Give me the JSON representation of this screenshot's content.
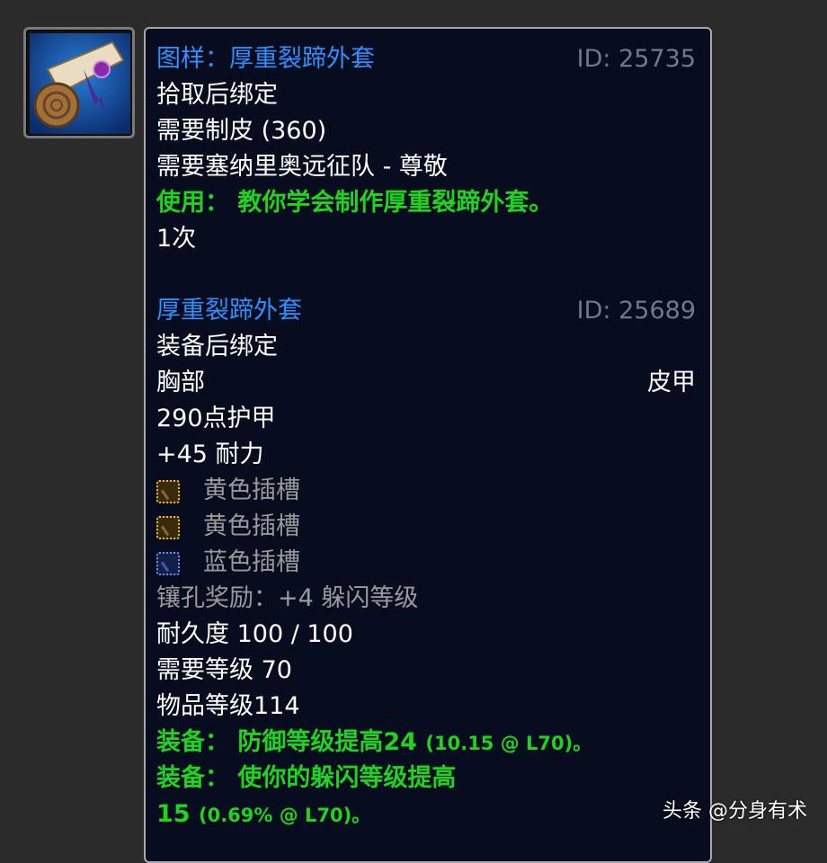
{
  "recipe": {
    "name": "图样：厚重裂蹄外套",
    "id": "ID: 25735",
    "bind": "拾取后绑定",
    "requires_skill": "需要制皮 (360)",
    "requires_rep": "需要塞纳里奥远征队 - 尊敬",
    "use_text": "使用： 教你学会制作厚重裂蹄外套。",
    "charges": "1次"
  },
  "item": {
    "name": "厚重裂蹄外套",
    "id": "ID: 25689",
    "bind": "装备后绑定",
    "slot": "胸部",
    "type": "皮甲",
    "armor": "290点护甲",
    "stamina": "+45 耐力",
    "sockets": [
      {
        "label": "黄色插槽",
        "color": "yellow"
      },
      {
        "label": "黄色插槽",
        "color": "yellow"
      },
      {
        "label": "蓝色插槽",
        "color": "blue"
      }
    ],
    "socket_bonus": "镶孔奖励：+4 躲闪等级",
    "durability": "耐久度 100 / 100",
    "req_level": "需要等级 70",
    "item_level": "物品等级114",
    "equip1_main": "装备： 防御等级提高24",
    "equip1_detail": "(10.15 @ L70)。",
    "equip2_main": "装备： 使你的躲闪等级提高",
    "equip2_cont": "15",
    "equip2_detail": "(0.69% @ L70)。"
  },
  "watermark": "头条 @分身有术",
  "colors": {
    "name_blue": "#2e8fff",
    "use_green": "#1ed41e",
    "socket_yellow": "#e8b93a",
    "socket_blue": "#6f8fe8",
    "id_gray": "#6e7a8c"
  },
  "icons": [
    "recipe-scroll-icon",
    "yellow-socket-icon",
    "blue-socket-icon"
  ]
}
